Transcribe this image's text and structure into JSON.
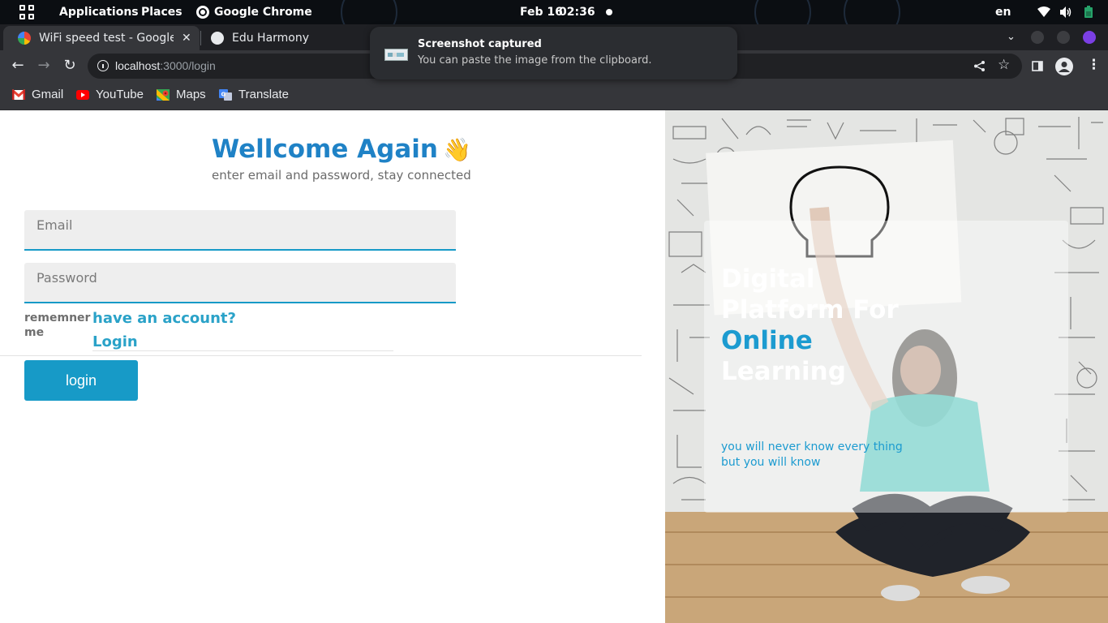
{
  "system_bar": {
    "applications": "Applications",
    "places": "Places",
    "active_app": "Google Chrome",
    "date": "Feb 16",
    "time": "02:36",
    "language": "en"
  },
  "tabs": [
    {
      "title": "WiFi speed test - Google s",
      "favicon": "google-icon",
      "active": true
    },
    {
      "title": "Edu Harmony",
      "favicon": "globe-icon",
      "active": false
    }
  ],
  "toolbar": {
    "url_host": "localhost",
    "url_path": ":3000/login"
  },
  "bookmarks": [
    {
      "label": "Gmail",
      "icon": "gmail-icon"
    },
    {
      "label": "YouTube",
      "icon": "youtube-icon"
    },
    {
      "label": "Maps",
      "icon": "maps-icon"
    },
    {
      "label": "Translate",
      "icon": "translate-icon"
    }
  ],
  "notification": {
    "title": "Screenshot captured",
    "body": "You can paste the image from the clipboard."
  },
  "login": {
    "heading": "Wellcome Again",
    "wave": "👋",
    "subtitle": "enter email and password, stay connected",
    "email_placeholder": "Email",
    "password_placeholder": "Password",
    "remember_label": "rememner me",
    "have_account": "have an account?",
    "login_link": "Login",
    "login_button": "login"
  },
  "hero": {
    "title_line1": "Digital",
    "title_line2": "Platform For",
    "title_accent": "Online",
    "title_line4": "Learning",
    "subtitle": "you will never know every thing but you will know"
  },
  "colors": {
    "accent_blue": "#179ac7",
    "heading_blue": "#1f82c6",
    "field_bg": "#eeeeee"
  }
}
